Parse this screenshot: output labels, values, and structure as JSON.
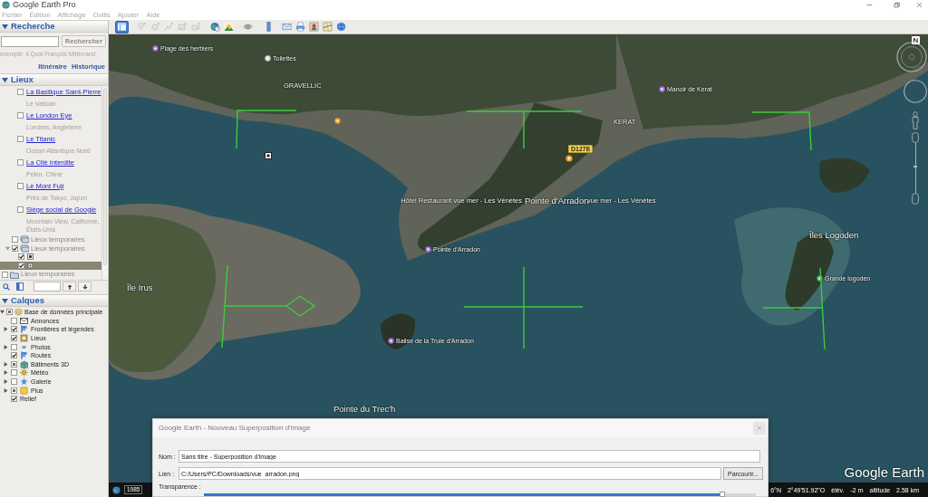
{
  "window": {
    "title": "Google Earth Pro"
  },
  "menu": [
    {
      "label": "Fichier",
      "disabled": true
    },
    {
      "label": "Édition",
      "disabled": true
    },
    {
      "label": "Affichage",
      "disabled": true
    },
    {
      "label": "Outils",
      "disabled": true
    },
    {
      "label": "Ajouter",
      "disabled": true
    },
    {
      "label": "Aide",
      "disabled": true
    }
  ],
  "toolbar": {
    "items": [
      {
        "selected": true,
        "disabled": false
      },
      {
        "selected": false,
        "disabled": true
      },
      {
        "selected": false,
        "disabled": true
      },
      {
        "selected": false,
        "disabled": true
      },
      {
        "selected": false,
        "disabled": true
      },
      {
        "selected": false,
        "disabled": true
      },
      {
        "selected": false,
        "disabled": false
      },
      {
        "selected": false,
        "disabled": false
      },
      {
        "selected": false,
        "disabled": false
      },
      {
        "selected": false,
        "disabled": false
      },
      {
        "selected": false,
        "disabled": false
      },
      {
        "selected": false,
        "disabled": false
      },
      {
        "selected": false,
        "disabled": false
      },
      {
        "selected": false,
        "disabled": false
      },
      {
        "selected": false,
        "disabled": false
      }
    ]
  },
  "search": {
    "title": "Recherche",
    "expanded": true,
    "button": {
      "label": "Rechercher",
      "disabled": true
    },
    "hint": "exemple: 4 Quai François Mitterrand,",
    "links": [
      "Itinéraire",
      "Historique"
    ]
  },
  "places": {
    "title": "Lieux",
    "expanded": true,
    "items": [
      {
        "kind": "place",
        "title": "La Basilique Saint-Pierre",
        "subtitle": "Le Vatican",
        "checked": false,
        "selected": false
      },
      {
        "kind": "place",
        "title": "Le London Eye",
        "subtitle": "Londres, Angleterre",
        "checked": false,
        "selected": false
      },
      {
        "kind": "place",
        "title": "Le Titanic",
        "subtitle": "Océan Atlantique Nord",
        "checked": false,
        "selected": false
      },
      {
        "kind": "place",
        "title": "La Cité Interdite",
        "subtitle": "Pékin, Chine",
        "checked": false,
        "selected": false
      },
      {
        "kind": "place",
        "title": "Le Mont Fuji",
        "subtitle": "Près de Tokyo, Japon",
        "checked": false,
        "selected": false
      },
      {
        "kind": "place",
        "title": "Siège social de Google",
        "subtitle": "Mountain View, Californie, États-Unis",
        "checked": false,
        "selected": false
      },
      {
        "kind": "temp_folder",
        "title": "Lieux temporaires",
        "checked": false,
        "selected": false
      },
      {
        "kind": "temp_folder",
        "title": "Lieux temporaires",
        "checked": true,
        "selected": false,
        "expanded": true,
        "children": [
          {
            "kind": "placemark",
            "checked": true,
            "selected": false
          },
          {
            "kind": "image_overlay",
            "checked": true,
            "selected": true
          }
        ]
      },
      {
        "kind": "folder",
        "title": "Lieux temporaires",
        "checked": false,
        "selected": false
      }
    ]
  },
  "layers": {
    "title": "Calques",
    "expanded": true,
    "items": [
      {
        "label": "Base de données principale",
        "checked": false,
        "mixed": true,
        "expanded": true,
        "children": [
          {
            "label": "Annonces",
            "checked": false,
            "mixed": false
          },
          {
            "label": "Frontières et légendes",
            "checked": true,
            "mixed": false,
            "expanded": false
          },
          {
            "label": "Lieux",
            "checked": true,
            "mixed": false
          },
          {
            "label": "Photos",
            "checked": false,
            "mixed": false,
            "expanded": false
          },
          {
            "label": "Routes",
            "checked": true,
            "mixed": false
          },
          {
            "label": "Bâtiments 3D",
            "checked": false,
            "mixed": true,
            "expanded": false
          },
          {
            "label": "Météo",
            "checked": false,
            "mixed": false,
            "expanded": false
          },
          {
            "label": "Galerie",
            "checked": false,
            "mixed": false,
            "expanded": false
          },
          {
            "label": "Plus",
            "checked": false,
            "mixed": true,
            "expanded": false
          },
          {
            "label": "Relief",
            "checked": true,
            "mixed": false
          }
        ]
      }
    ]
  },
  "map": {
    "labels": [
      {
        "kind": "poi",
        "text": "Plage des herbiers",
        "color": "#a46bd6"
      },
      {
        "kind": "poi",
        "text": "Toilettes",
        "color": "#d8d8d8"
      },
      {
        "kind": "place",
        "text": "GRAVELLIC"
      },
      {
        "kind": "poi",
        "text": "Manoir de Kerat",
        "color": "#a070d8"
      },
      {
        "kind": "place",
        "text": "KERAT"
      },
      {
        "kind": "road",
        "text": "D127E"
      },
      {
        "kind": "place",
        "text": "Hôtel Restaurant vue mer - Les Vénètes"
      },
      {
        "kind": "major",
        "text": "Pointe d'Arradon"
      },
      {
        "kind": "place",
        "text": "vue mer - Les Vénètes"
      },
      {
        "kind": "poi",
        "text": "Pointe d'Arradon",
        "color": "#9d70d8"
      },
      {
        "kind": "major",
        "text": "Île Irus"
      },
      {
        "kind": "major",
        "text": "Îles Logoden"
      },
      {
        "kind": "poi",
        "text": "Grande logoden",
        "color": "#4fb06a"
      },
      {
        "kind": "poi",
        "text": "Balise de la Truie d'Arradon",
        "color": "#a46bd6"
      },
      {
        "kind": "major",
        "text": "Pointe du Trec'h"
      }
    ],
    "navigation": {
      "north": "N",
      "zoom": {
        "level": 0.53
      }
    },
    "logo": "Google Earth"
  },
  "status_bar": {
    "date": "1985",
    "items": [
      "6°N",
      "2°49'51.92\"O",
      "élév.",
      "-2 m",
      "altitude",
      "2.58 km"
    ]
  },
  "dialog": {
    "title": "Google Earth - Nouveau Superposition d'image",
    "fields": [
      {
        "label": "Nom :",
        "value": "Sans titre - Superposition d'image"
      },
      {
        "label": "Lien :",
        "value": "C:/Users/PC/Downloads/vue_arradon.png",
        "button": "Parcourir..."
      }
    ],
    "transparency": {
      "label": "Transparence :",
      "level": 0.94
    }
  }
}
